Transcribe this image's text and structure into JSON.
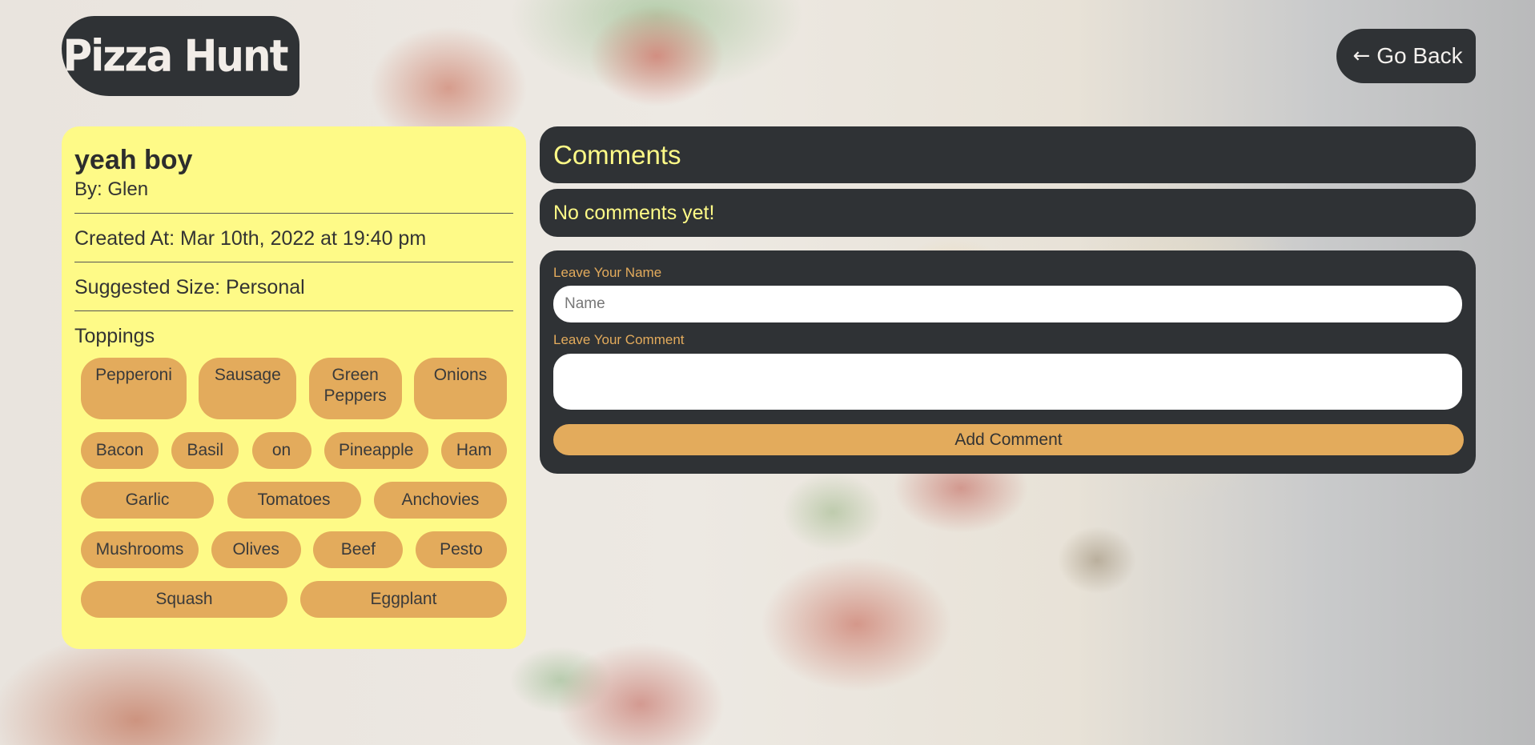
{
  "header": {
    "logo_text": "Pizza Hunt",
    "back_label": "Go Back",
    "back_icon": "left-arrow-icon"
  },
  "pizza": {
    "name": "yeah boy",
    "author": "By: Glen",
    "created_at": "Created At: Mar 10th, 2022 at 19:40 pm",
    "suggested_size": "Suggested Size: Personal",
    "toppings_label": "Toppings",
    "toppings": [
      "Pepperoni",
      "Sausage",
      "Green Peppers",
      "Onions",
      "Bacon",
      "Basil",
      "on",
      "Pineapple",
      "Ham",
      "Garlic",
      "Tomatoes",
      "Anchovies",
      "Mushrooms",
      "Olives",
      "Beef",
      "Pesto",
      "Squash",
      "Eggplant"
    ]
  },
  "comments": {
    "title": "Comments",
    "empty_message": "No comments yet!",
    "form": {
      "name_label": "Leave Your Name",
      "name_placeholder": "Name",
      "name_value": "",
      "comment_label": "Leave Your Comment",
      "comment_value": "",
      "submit_label": "Add Comment"
    }
  },
  "colors": {
    "dark_panel": "#2f3235",
    "card_yellow": "#fefa87",
    "accent_orange": "#e3ab5c",
    "heading_yellow": "#fefa87"
  }
}
